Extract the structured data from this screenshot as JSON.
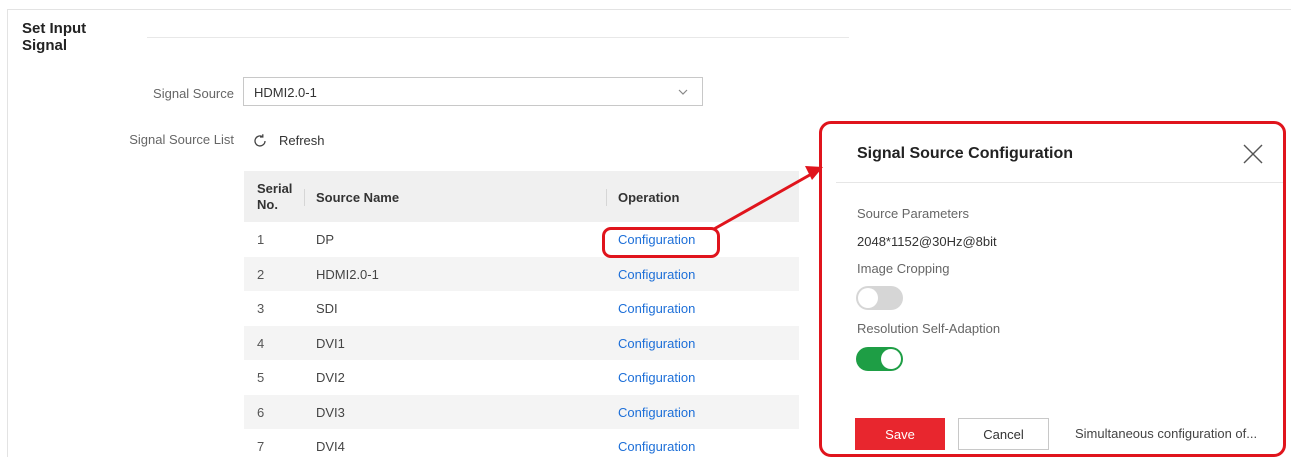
{
  "page": {
    "title": "Set Input Signal"
  },
  "form": {
    "signal_source_label": "Signal Source",
    "signal_source_value": "HDMI2.0-1",
    "signal_source_list_label": "Signal Source List",
    "refresh_label": "Refresh"
  },
  "table": {
    "headers": {
      "serial": "Serial No.",
      "name": "Source Name",
      "operation": "Operation"
    },
    "rows": [
      {
        "no": "1",
        "name": "DP",
        "op": "Configuration"
      },
      {
        "no": "2",
        "name": "HDMI2.0-1",
        "op": "Configuration"
      },
      {
        "no": "3",
        "name": "SDI",
        "op": "Configuration"
      },
      {
        "no": "4",
        "name": "DVI1",
        "op": "Configuration"
      },
      {
        "no": "5",
        "name": "DVI2",
        "op": "Configuration"
      },
      {
        "no": "6",
        "name": "DVI3",
        "op": "Configuration"
      },
      {
        "no": "7",
        "name": "DVI4",
        "op": "Configuration"
      }
    ]
  },
  "dialog": {
    "title": "Signal Source Configuration",
    "source_params_label": "Source Parameters",
    "source_params_value": "2048*1152@30Hz@8bit",
    "image_cropping_label": "Image Cropping",
    "image_cropping_on": false,
    "resolution_label": "Resolution Self-Adaption",
    "resolution_on": true,
    "save_label": "Save",
    "cancel_label": "Cancel",
    "simultaneous_label": "Simultaneous configuration of..."
  },
  "colors": {
    "link": "#1d6fd8",
    "highlight": "#e0141c",
    "save_button": "#e8262e",
    "toggle_on": "#1e9e45",
    "toggle_off": "#d6d6d6"
  }
}
